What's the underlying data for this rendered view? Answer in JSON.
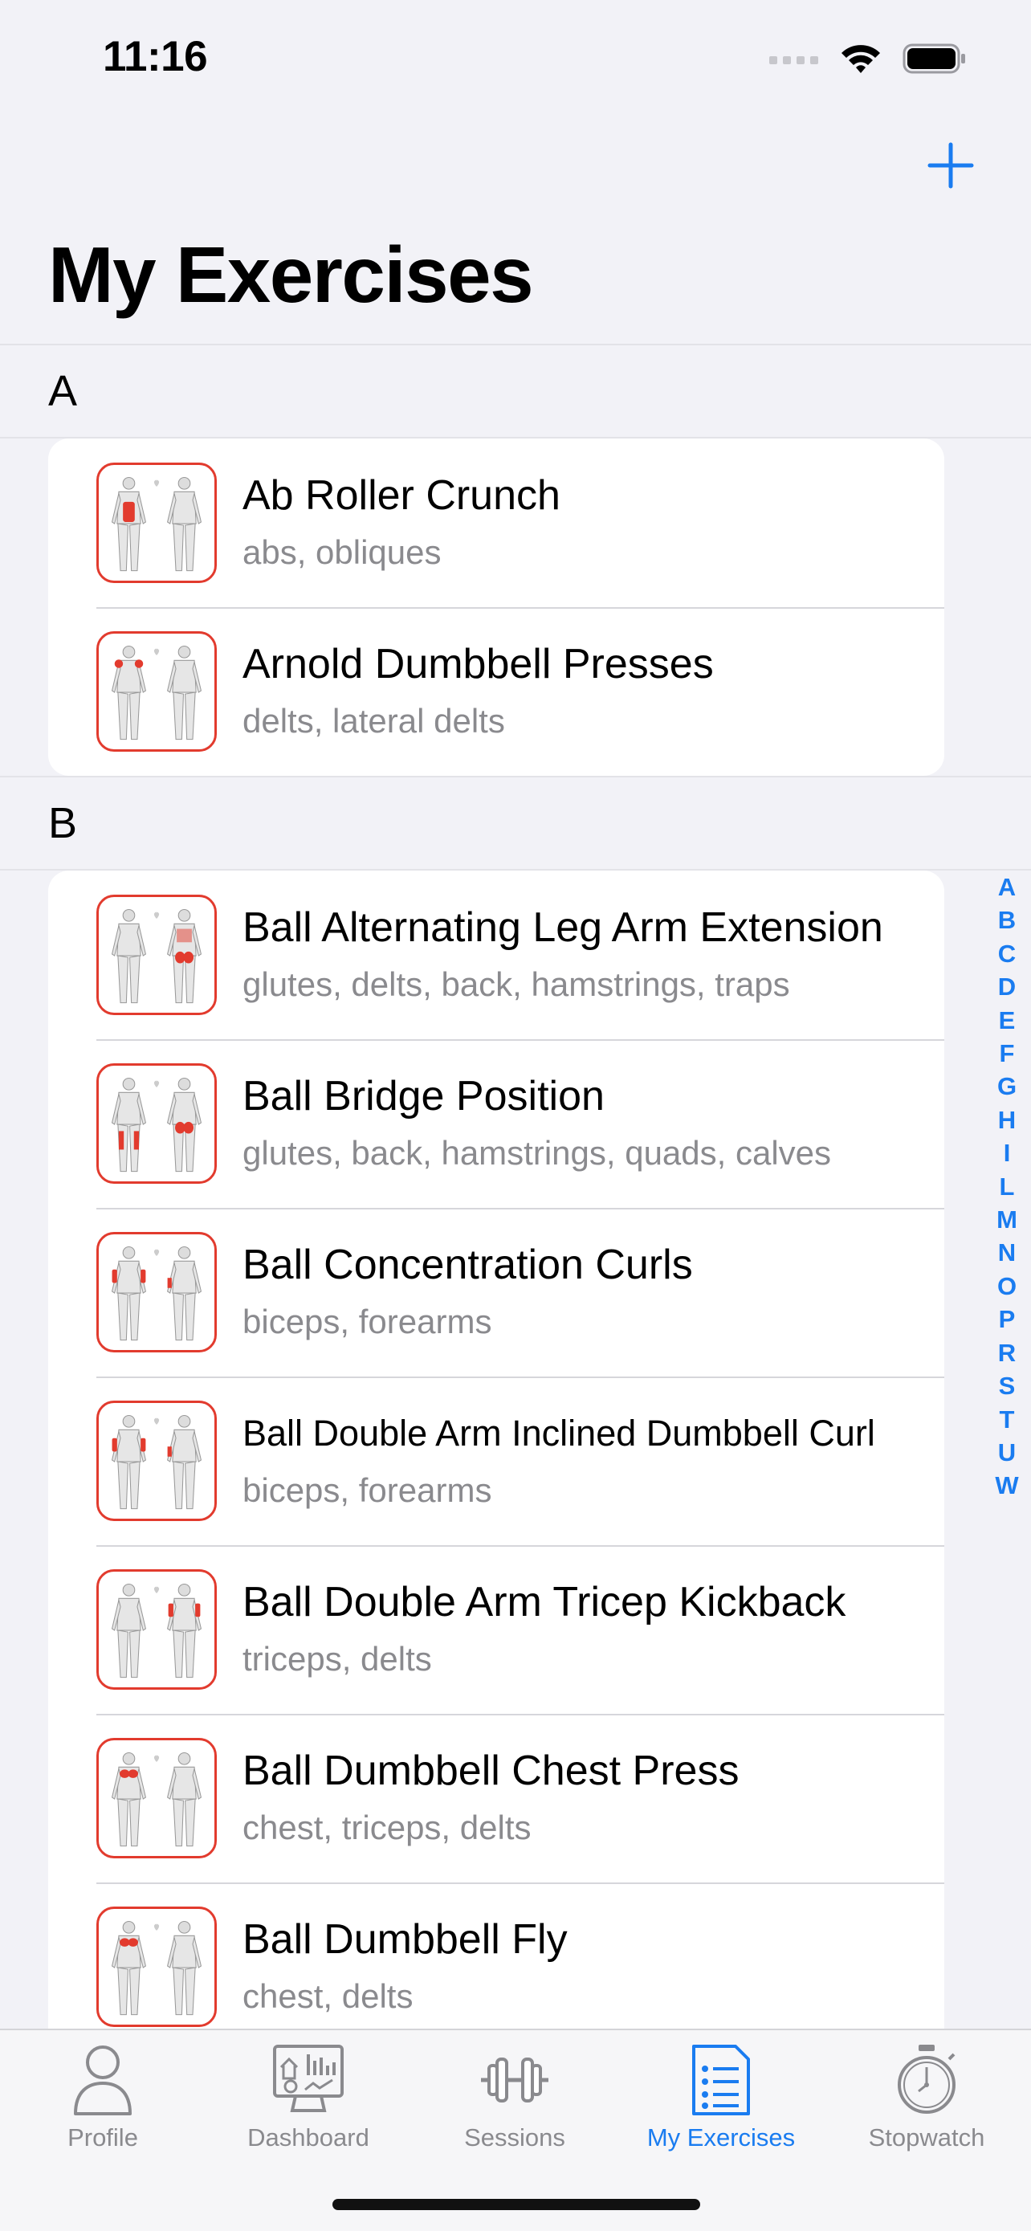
{
  "status": {
    "time": "11:16"
  },
  "header": {
    "add_icon": "plus-icon",
    "title": "My Exercises"
  },
  "sections": [
    {
      "letter": "A",
      "items": [
        {
          "title": "Ab Roller Crunch",
          "muscles": "abs, obliques",
          "highlight": "abs"
        },
        {
          "title": "Arnold Dumbbell Presses",
          "muscles": "delts, lateral delts",
          "highlight": "delts"
        }
      ]
    },
    {
      "letter": "B",
      "items": [
        {
          "title": "Ball Alternating Leg Arm Extension",
          "muscles": "glutes, delts, back, hamstrings, traps",
          "highlight": "glutes"
        },
        {
          "title": "Ball Bridge Position",
          "muscles": "glutes, back, hamstrings, quads, calves",
          "highlight": "legs"
        },
        {
          "title": "Ball Concentration Curls",
          "muscles": "biceps, forearms",
          "highlight": "arms"
        },
        {
          "title": "Ball Double Arm Inclined Dumbbell Curl",
          "muscles": "biceps, forearms",
          "highlight": "arms"
        },
        {
          "title": "Ball Double Arm Tricep Kickback",
          "muscles": "triceps, delts",
          "highlight": "triceps"
        },
        {
          "title": "Ball Dumbbell Chest Press",
          "muscles": "chest, triceps, delts",
          "highlight": "chest"
        },
        {
          "title": "Ball Dumbbell Fly",
          "muscles": "chest, delts",
          "highlight": "chest"
        }
      ]
    }
  ],
  "index_letters": [
    "A",
    "B",
    "C",
    "D",
    "E",
    "F",
    "G",
    "H",
    "I",
    "L",
    "M",
    "N",
    "O",
    "P",
    "R",
    "S",
    "T",
    "U",
    "W"
  ],
  "tabs": [
    {
      "label": "Profile",
      "icon": "person-icon",
      "active": false
    },
    {
      "label": "Dashboard",
      "icon": "dashboard-icon",
      "active": false
    },
    {
      "label": "Sessions",
      "icon": "dumbbell-icon",
      "active": false
    },
    {
      "label": "My Exercises",
      "icon": "list-document-icon",
      "active": true
    },
    {
      "label": "Stopwatch",
      "icon": "stopwatch-icon",
      "active": false
    }
  ],
  "colors": {
    "accent": "#1a7cf0",
    "muscle": "#e23b2e",
    "secondary_text": "#8a8a8e",
    "background": "#f2f2f7"
  }
}
